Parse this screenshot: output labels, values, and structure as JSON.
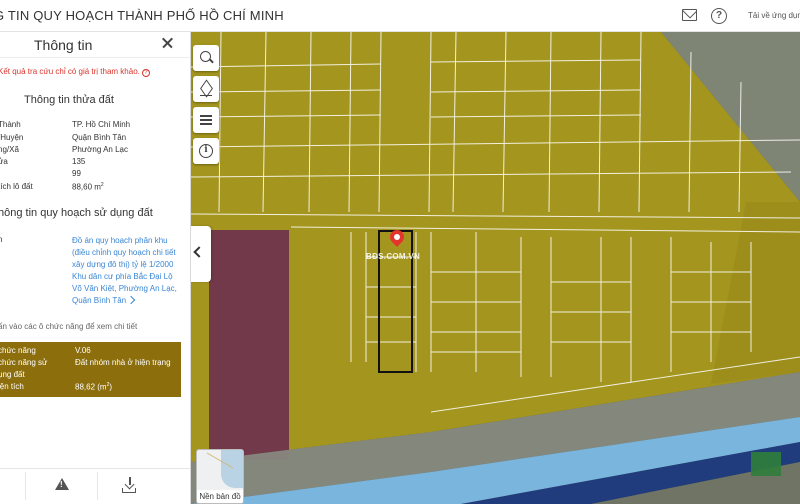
{
  "header": {
    "title": "G TIN QUY HOẠCH THÀNH PHỐ HỒ CHÍ MINH",
    "download_app": "Tải về ứng dụng",
    "mail_icon": "mail-icon",
    "help_icon": "help-icon"
  },
  "panel": {
    "title": "Thông tin",
    "disclaimer": "Kết quả tra cứu chỉ có giá trị tham khảo.",
    "parcel_section": "Thông tin thửa đất",
    "parcel_rows": [
      {
        "label": "Thành",
        "value": "TP. Hồ Chí Minh"
      },
      {
        "label": "/Huyện",
        "value": "Quận Bình Tân"
      },
      {
        "label": "ng/Xã",
        "value": "Phường An Lạc"
      },
      {
        "label": "ửa",
        "value": "135"
      },
      {
        "label": "",
        "value": "99"
      },
      {
        "label": "tích lô đất",
        "value": "88,60 m",
        "unit_sup": "2"
      }
    ],
    "planning_section": "hông tin quy hoạch sử dụng đất",
    "planning_label": "n",
    "planning_link": "Đồ án quy hoạch phân khu (điều chỉnh quy hoạch chi tiết xây dựng đô thị) tỷ lệ 1/2000 Khu dân cư phía Bắc Đại Lộ Võ Văn Kiệt, Phường An Lạc, Quận Bình Tân",
    "hint": "ấn vào các ô chức năng để xem chi tiết",
    "zone": {
      "rows": [
        {
          "label": "chức năng",
          "value": "V.06"
        },
        {
          "label": "chức năng sử",
          "value": "Đất nhóm nhà ở hiện trạng"
        },
        {
          "label": "ụng đất",
          "value": ""
        },
        {
          "label": "iện tích",
          "value": "88,62 (m",
          "unit_sup": "2",
          "unit_close": ")"
        }
      ],
      "color": "#8c6e0c"
    }
  },
  "map": {
    "watermark": "BĐS.COM.VN",
    "basemap_label": "Nền bản đồ",
    "tools": [
      "search-icon",
      "layers-icon",
      "legend-list-icon",
      "info-icon"
    ],
    "overlay_colors": {
      "residential": "#b8a30f",
      "mixed": "#6b2f4e",
      "road": "#777777",
      "water": "#6aa9d4",
      "public": "#1f3a7a",
      "green": "#2f7d3a"
    }
  }
}
